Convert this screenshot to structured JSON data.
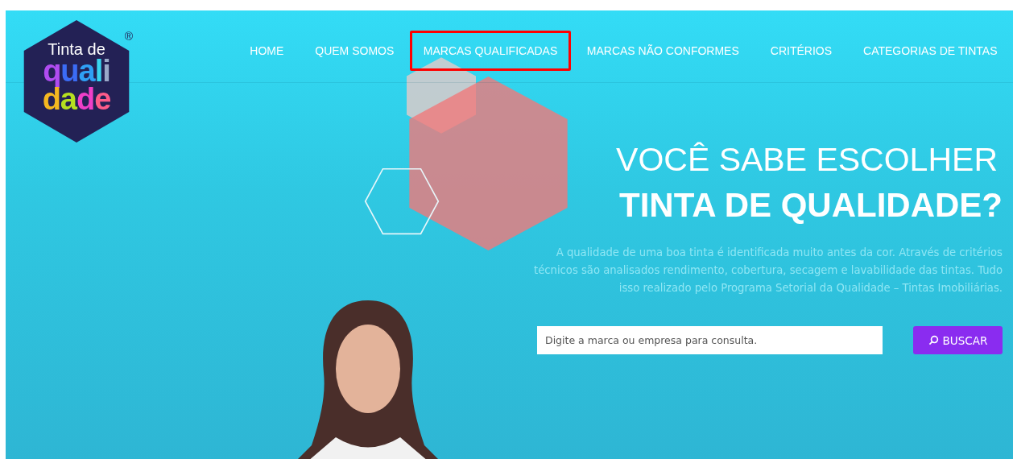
{
  "logo": {
    "line1": "Tinta de",
    "line2": "quali",
    "line3": "dade",
    "registered": "®"
  },
  "nav": [
    {
      "label": "HOME",
      "selected": false
    },
    {
      "label": "QUEM SOMOS",
      "selected": false
    },
    {
      "label": "MARCAS QUALIFICADAS",
      "selected": true
    },
    {
      "label": "MARCAS NÃO CONFORMES",
      "selected": false
    },
    {
      "label": "CRITÉRIOS",
      "selected": false
    },
    {
      "label": "CATEGORIAS DE TINTAS",
      "selected": false
    }
  ],
  "hero": {
    "title_line1": "VOCÊ SABE ESCOLHER",
    "title_line2": "TINTA DE QUALIDADE?",
    "text": "A qualidade de uma boa tinta é identificada muito antes da cor. Através de critérios técnicos são analisados rendimento, cobertura, secagem e lavabilidade das tintas. Tudo isso realizado pelo Programa Setorial da Qualidade – Tintas Imobiliárias."
  },
  "search": {
    "placeholder": "Digite a marca ou empresa para consulta.",
    "button": "BUSCAR"
  }
}
